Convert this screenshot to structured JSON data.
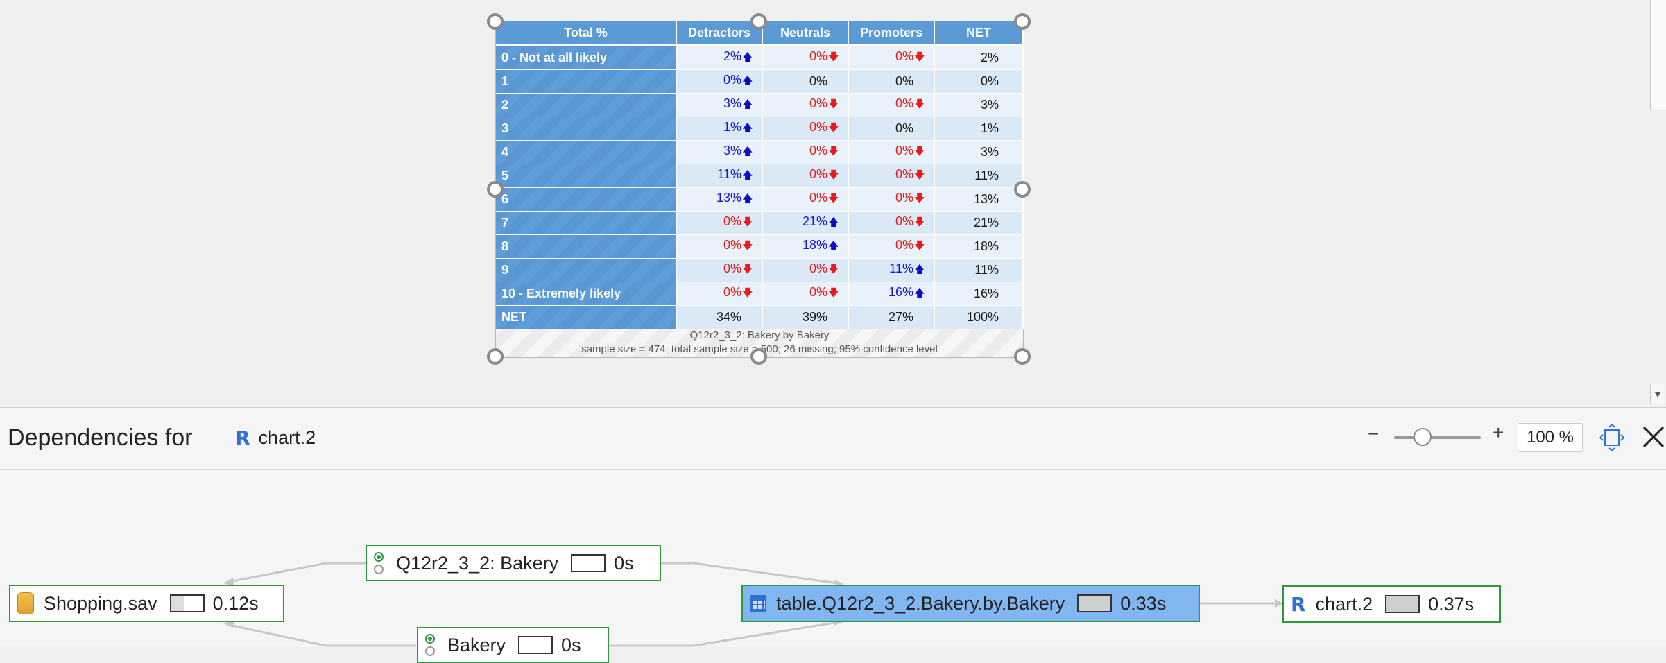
{
  "table": {
    "header": [
      "Total %",
      "Detractors",
      "Neutrals",
      "Promoters",
      "NET"
    ],
    "rows": [
      {
        "label": "0 - Not at all likely",
        "cells": [
          {
            "v": "2%",
            "d": "up"
          },
          {
            "v": "0%",
            "d": "down"
          },
          {
            "v": "0%",
            "d": "down"
          }
        ],
        "net": "2%"
      },
      {
        "label": "1",
        "cells": [
          {
            "v": "0%",
            "d": "up"
          },
          {
            "v": "0%",
            "d": "none"
          },
          {
            "v": "0%",
            "d": "none"
          }
        ],
        "net": "0%"
      },
      {
        "label": "2",
        "cells": [
          {
            "v": "3%",
            "d": "up"
          },
          {
            "v": "0%",
            "d": "down"
          },
          {
            "v": "0%",
            "d": "down"
          }
        ],
        "net": "3%"
      },
      {
        "label": "3",
        "cells": [
          {
            "v": "1%",
            "d": "up"
          },
          {
            "v": "0%",
            "d": "down"
          },
          {
            "v": "0%",
            "d": "none"
          }
        ],
        "net": "1%"
      },
      {
        "label": "4",
        "cells": [
          {
            "v": "3%",
            "d": "up"
          },
          {
            "v": "0%",
            "d": "down"
          },
          {
            "v": "0%",
            "d": "down"
          }
        ],
        "net": "3%"
      },
      {
        "label": "5",
        "cells": [
          {
            "v": "11%",
            "d": "up"
          },
          {
            "v": "0%",
            "d": "down"
          },
          {
            "v": "0%",
            "d": "down"
          }
        ],
        "net": "11%"
      },
      {
        "label": "6",
        "cells": [
          {
            "v": "13%",
            "d": "up"
          },
          {
            "v": "0%",
            "d": "down"
          },
          {
            "v": "0%",
            "d": "down"
          }
        ],
        "net": "13%"
      },
      {
        "label": "7",
        "cells": [
          {
            "v": "0%",
            "d": "down"
          },
          {
            "v": "21%",
            "d": "up"
          },
          {
            "v": "0%",
            "d": "down"
          }
        ],
        "net": "21%"
      },
      {
        "label": "8",
        "cells": [
          {
            "v": "0%",
            "d": "down"
          },
          {
            "v": "18%",
            "d": "up"
          },
          {
            "v": "0%",
            "d": "down"
          }
        ],
        "net": "18%"
      },
      {
        "label": "9",
        "cells": [
          {
            "v": "0%",
            "d": "down"
          },
          {
            "v": "0%",
            "d": "down"
          },
          {
            "v": "11%",
            "d": "up"
          }
        ],
        "net": "11%"
      },
      {
        "label": "10 - Extremely likely",
        "cells": [
          {
            "v": "0%",
            "d": "down"
          },
          {
            "v": "0%",
            "d": "down"
          },
          {
            "v": "16%",
            "d": "up"
          }
        ],
        "net": "16%"
      },
      {
        "label": "NET",
        "cells": [
          {
            "v": "34%",
            "d": "none"
          },
          {
            "v": "39%",
            "d": "none"
          },
          {
            "v": "27%",
            "d": "none"
          }
        ],
        "net": "100%"
      }
    ],
    "footer_line1": "Q12r2_3_2: Bakery by Bakery",
    "footer_line2": "sample size = 474; total sample size = 500; 26 missing; 95% confidence level",
    "colors": {
      "header": "#5b9bd5",
      "up": "#1515d8",
      "down": "#ea1b1b"
    }
  },
  "deps": {
    "title": "Dependencies for",
    "target": "chart.2",
    "target_icon": "r-icon",
    "zoom_minus": "−",
    "zoom_plus": "+",
    "zoom_level": 1.0,
    "zoom_text": "100 %",
    "nodes": {
      "question": {
        "label": "Q12r2_3_2: Bakery",
        "time": "0s",
        "icon": "radio-icon"
      },
      "source": {
        "label": "Shopping.sav",
        "time": "0.12s",
        "icon": "database-icon"
      },
      "variable": {
        "label": "Bakery",
        "time": "0s",
        "icon": "radio-icon"
      },
      "table": {
        "label": "table.Q12r2_3_2.Bakery.by.Bakery",
        "time": "0.33s",
        "icon": "table-icon"
      },
      "chart": {
        "label": "chart.2",
        "time": "0.37s",
        "icon": "r-icon"
      }
    }
  },
  "icons": {
    "up_arrow": "🡅",
    "down_arrow": "🡇",
    "scroll_down": "▼"
  }
}
